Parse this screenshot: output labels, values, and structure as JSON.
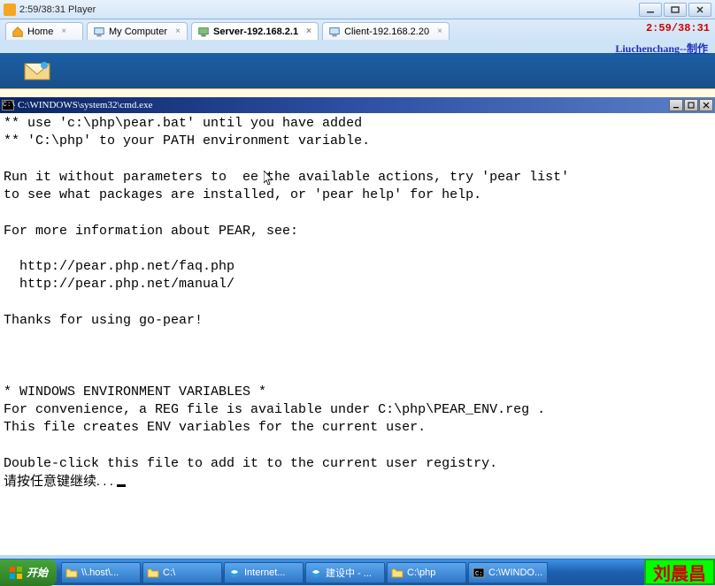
{
  "player": {
    "title": "2:59/38:31 Player"
  },
  "window_controls": {
    "min": "min",
    "max": "max",
    "close": "close"
  },
  "tabs": [
    {
      "label": "Home",
      "icon": "home"
    },
    {
      "label": "My Computer",
      "icon": "computer"
    },
    {
      "label": "Server-192.168.2.1",
      "icon": "server",
      "active": true
    },
    {
      "label": "Client-192.168.2.20",
      "icon": "client"
    }
  ],
  "timer": "2:59/38:31",
  "author": "Liuchenchang--制作",
  "cmd": {
    "icon_label": "C:\\",
    "title": "C:\\WINDOWS\\system32\\cmd.exe",
    "body": "** use 'c:\\php\\pear.bat' until you have added\n** 'C:\\php' to your PATH environment variable.\n\nRun it without parameters to  ee the available actions, try 'pear list'\nto see what packages are installed, or 'pear help' for help.\n\nFor more information about PEAR, see:\n\n  http://pear.php.net/faq.php\n  http://pear.php.net/manual/\n\nThanks for using go-pear!\n\n\n\n* WINDOWS ENVIRONMENT VARIABLES *\nFor convenience, a REG file is available under C:\\php\\PEAR_ENV.reg .\nThis file creates ENV variables for the current user.\n\nDouble-click this file to add it to the current user registry.\n",
    "prompt_cn": "请按任意键继续. . . "
  },
  "taskbar": {
    "start": "开始",
    "items": [
      {
        "label": "\\\\.host\\...",
        "icon": "folder"
      },
      {
        "label": "C:\\",
        "icon": "folder"
      },
      {
        "label": "Internet...",
        "icon": "ie"
      },
      {
        "label": "建设中 - ...",
        "icon": "ie"
      },
      {
        "label": "C:\\php",
        "icon": "folder"
      },
      {
        "label": "C:\\WINDO...",
        "icon": "cmd"
      }
    ]
  },
  "watermark": "刘晨昌"
}
